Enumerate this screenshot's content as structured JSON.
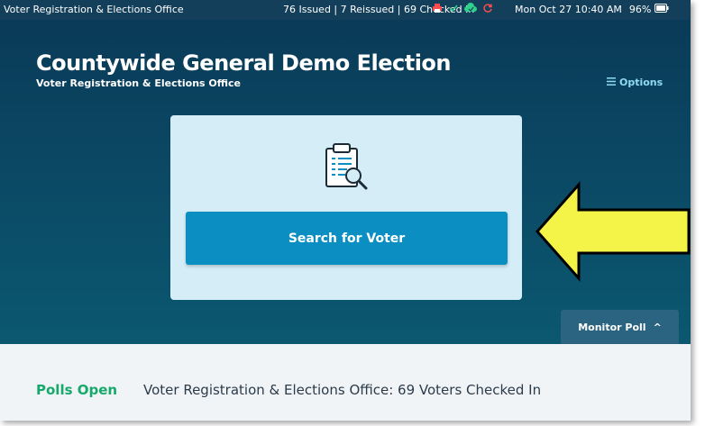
{
  "statusbar": {
    "office": "Voter Registration & Elections Office",
    "counts": "76 Issued | 7 Reissued | 69 Checked In",
    "datetime": "Mon Oct 27  10:40 AM",
    "battery": "96%",
    "icons": [
      "printer-icon",
      "check-icon",
      "cloud-icon",
      "refresh-icon",
      "battery-icon"
    ],
    "colors": {
      "printer": "#ff4d4d",
      "check": "#2fd18a",
      "cloud": "#2fd18a",
      "refresh": "#ff4d4d"
    }
  },
  "header": {
    "title": "Countywide General Demo Election",
    "subtitle": "Voter Registration & Elections Office",
    "options_label": "Options",
    "options_icon": "menu-icon"
  },
  "card": {
    "icon": "clipboard-search-icon",
    "search_label": "Search for Voter"
  },
  "monitor": {
    "label": "Monitor Poll",
    "caret": "^"
  },
  "footer": {
    "status": "Polls Open",
    "message": "Voter Registration & Elections Office: 69 Voters Checked In"
  },
  "colors": {
    "hero": "#0b4b66",
    "accent_button": "#0b8fc2",
    "polls_open": "#17a86b",
    "arrow": "#f4f348"
  }
}
